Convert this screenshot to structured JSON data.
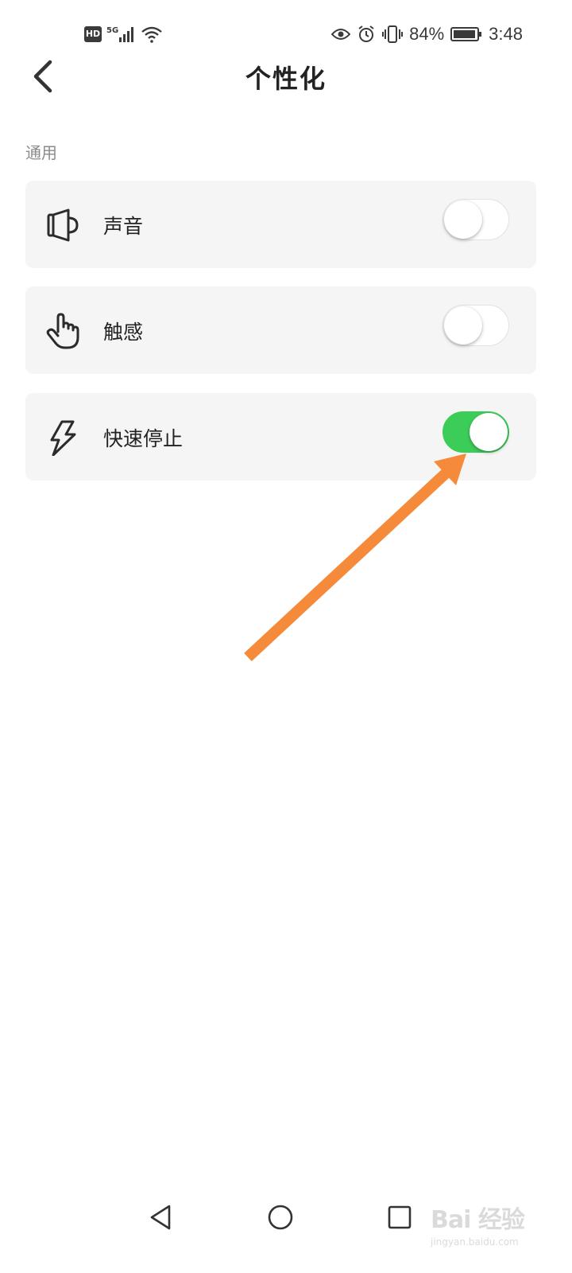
{
  "status_bar": {
    "hd": "HD",
    "network": "5G",
    "battery_percent": "84%",
    "time": "3:48",
    "icons": [
      "hd-icon",
      "signal-icon",
      "wifi-icon",
      "eye-icon",
      "alarm-icon",
      "vibrate-icon",
      "battery-icon"
    ]
  },
  "header": {
    "title": "个性化",
    "back_icon": "chevron-left-icon"
  },
  "section": {
    "label": "通用"
  },
  "settings": [
    {
      "label": "声音",
      "icon": "speaker-icon",
      "enabled": false
    },
    {
      "label": "触感",
      "icon": "hand-tap-icon",
      "enabled": false
    },
    {
      "label": "快速停止",
      "icon": "lightning-icon",
      "enabled": true
    }
  ],
  "colors": {
    "toggle_on": "#3ccd58",
    "card_bg": "#f5f5f5",
    "annotation_arrow": "#f58a3a"
  },
  "nav_bar": {
    "icons": [
      "nav-back-icon",
      "nav-home-icon",
      "nav-recent-icon"
    ]
  },
  "watermark": {
    "text": "Bai 经验",
    "sub": "jingyan.baidu.com"
  }
}
